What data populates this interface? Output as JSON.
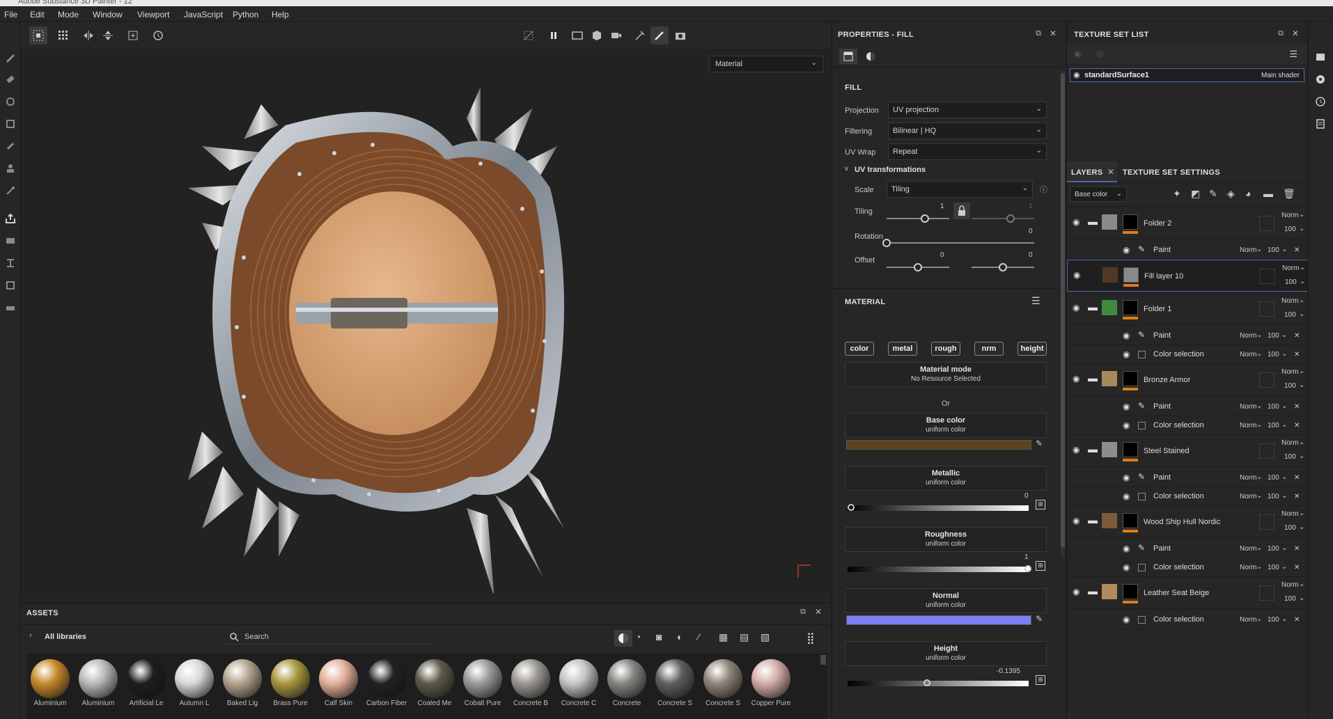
{
  "window": {
    "title": "Adobe Substance 3D Painter - 12"
  },
  "menu": [
    "File",
    "Edit",
    "Mode",
    "Window",
    "Viewport",
    "JavaScript",
    "Python",
    "Help"
  ],
  "viewport": {
    "view_mode": "Material"
  },
  "assets": {
    "title": "ASSETS",
    "library": "All libraries",
    "search_placeholder": "Search",
    "materials": [
      {
        "label": "Aluminium",
        "color": "#c88a2a"
      },
      {
        "label": "Aluminium",
        "color": "#b9b9b9"
      },
      {
        "label": "Artificial Le",
        "color": "#1e1e1e"
      },
      {
        "label": "Autumn L",
        "color": "#d8d8d8"
      },
      {
        "label": "Baked Lig",
        "color": "#b3a48e"
      },
      {
        "label": "Brass Pure",
        "color": "#a8983e"
      },
      {
        "label": "Calf Skin",
        "color": "#e3b09a"
      },
      {
        "label": "Carbon Fiber",
        "color": "#222222"
      },
      {
        "label": "Coated Me",
        "color": "#5e5a4a"
      },
      {
        "label": "Cobalt Pure",
        "color": "#9a9a9a"
      },
      {
        "label": "Concrete B",
        "color": "#9a9890"
      },
      {
        "label": "Concrete C",
        "color": "#c4c4c4"
      },
      {
        "label": "Concrete",
        "color": "#858582"
      },
      {
        "label": "Concrete S",
        "color": "#5f5f5f"
      },
      {
        "label": "Concrete S",
        "color": "#8f857a"
      },
      {
        "label": "Copper Pure",
        "color": "#d5aea8"
      }
    ]
  },
  "properties": {
    "title": "PROPERTIES - FILL",
    "fill": {
      "section": "FILL",
      "projection_label": "Projection",
      "projection": "UV projection",
      "filtering_label": "Filtering",
      "filtering": "Bilinear | HQ",
      "uvwrap_label": "UV Wrap",
      "uvwrap": "Repeat"
    },
    "uv": {
      "section": "UV transformations",
      "scale_label": "Scale",
      "scale": "Tiling",
      "tiling_label": "Tiling",
      "tiling_u": "1",
      "tiling_v": "1",
      "rotation_label": "Rotation",
      "rotation": "0",
      "offset_label": "Offset",
      "offset_u": "0",
      "offset_v": "0"
    },
    "material": {
      "section": "MATERIAL",
      "channels": [
        "color",
        "metal",
        "rough",
        "nrm",
        "height"
      ],
      "mode_title": "Material mode",
      "mode_sub": "No Resource Selected",
      "or": "Or",
      "base_color": {
        "title": "Base color",
        "sub": "uniform color",
        "swatch": "#5b4220"
      },
      "metallic": {
        "title": "Metallic",
        "sub": "uniform color",
        "value": "0",
        "level": 0.0
      },
      "roughness": {
        "title": "Roughness",
        "sub": "uniform color",
        "value": "1",
        "level": 1.0
      },
      "normal": {
        "title": "Normal",
        "sub": "uniform color",
        "swatch": "#7e7ef4"
      },
      "height": {
        "title": "Height",
        "sub": "uniform color",
        "value": "-0.1395",
        "level": 0.43
      }
    }
  },
  "texture_set_list": {
    "title": "TEXTURE SET LIST",
    "item": "standardSurface1",
    "shader": "Main shader"
  },
  "layers_panel": {
    "tab_layers": "LAYERS",
    "tab_settings": "TEXTURE SET SETTINGS",
    "channel": "Base color",
    "layers": [
      {
        "name": "Folder 2",
        "blend": "Norm",
        "opacity": "100",
        "thumb": "#8a8a8a",
        "subs": [
          {
            "name": "Paint",
            "blend": "Norm",
            "opacity": "100",
            "kind": "paint"
          }
        ]
      },
      {
        "name": "Fill layer 10",
        "blend": "Norm",
        "opacity": "100",
        "thumb": "#4e3a22",
        "selected": true,
        "subs": []
      },
      {
        "name": "Folder 1",
        "blend": "Norm",
        "opacity": "100",
        "thumb": "#3f8a3f",
        "subs": [
          {
            "name": "Paint",
            "blend": "Norm",
            "opacity": "100",
            "kind": "paint"
          },
          {
            "name": "Color selection",
            "blend": "Norm",
            "opacity": "100",
            "kind": "check"
          }
        ]
      },
      {
        "name": "Bronze Armor",
        "blend": "Norm",
        "opacity": "100",
        "thumb": "#a88a5a",
        "subs": [
          {
            "name": "Paint",
            "blend": "Norm",
            "opacity": "100",
            "kind": "paint"
          },
          {
            "name": "Color selection",
            "blend": "Norm",
            "opacity": "100",
            "kind": "check"
          }
        ]
      },
      {
        "name": "Steel Stained",
        "blend": "Norm",
        "opacity": "100",
        "thumb": "#8d8d8d",
        "subs": [
          {
            "name": "Paint",
            "blend": "Norm",
            "opacity": "100",
            "kind": "paint"
          },
          {
            "name": "Color selection",
            "blend": "Norm",
            "opacity": "100",
            "kind": "check"
          }
        ]
      },
      {
        "name": "Wood Ship Hull Nordic",
        "blend": "Norm",
        "opacity": "100",
        "thumb": "#7a5a3a",
        "subs": [
          {
            "name": "Paint",
            "blend": "Norm",
            "opacity": "100",
            "kind": "paint"
          },
          {
            "name": "Color selection",
            "blend": "Norm",
            "opacity": "100",
            "kind": "check"
          }
        ]
      },
      {
        "name": "Leather Seat Beige",
        "blend": "Norm",
        "opacity": "100",
        "thumb": "#b28a60",
        "subs": [
          {
            "name": "Color selection",
            "blend": "Norm",
            "opacity": "100",
            "kind": "check"
          }
        ]
      }
    ]
  }
}
